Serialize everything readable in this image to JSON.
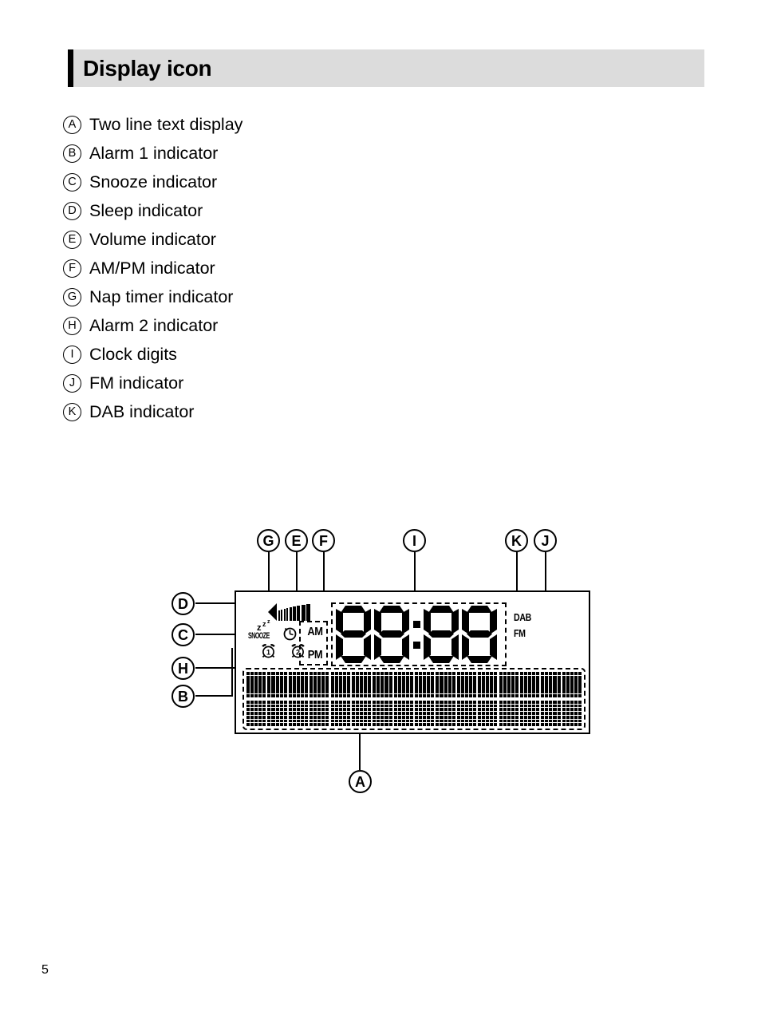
{
  "header": {
    "title": "Display icon",
    "bar_color": "#dcdcdc",
    "accent_color": "#000000"
  },
  "legend": {
    "items": [
      {
        "marker": "A",
        "label": "Two line text display"
      },
      {
        "marker": "B",
        "label": "Alarm 1 indicator"
      },
      {
        "marker": "C",
        "label": "Snooze indicator"
      },
      {
        "marker": "D",
        "label": "Sleep indicator"
      },
      {
        "marker": "E",
        "label": "Volume indicator"
      },
      {
        "marker": "F",
        "label": "AM/PM indicator"
      },
      {
        "marker": "G",
        "label": "Nap timer indicator"
      },
      {
        "marker": "H",
        "label": "Alarm 2 indicator"
      },
      {
        "marker": "I",
        "label": "Clock digits"
      },
      {
        "marker": "J",
        "label": "FM indicator"
      },
      {
        "marker": "K",
        "label": "DAB indicator"
      }
    ]
  },
  "diagram": {
    "callouts": {
      "g": "G",
      "e": "E",
      "f": "F",
      "i": "I",
      "k": "K",
      "j": "J",
      "d": "D",
      "c": "C",
      "h": "H",
      "b": "B",
      "a": "A"
    },
    "lcd": {
      "snooze_label": "SNOOZE",
      "sleep_icon": "zzz-sleep-icon",
      "volume_icon": "speaker-volume-icon",
      "nap_timer_icon": "nap-timer-clock-icon",
      "alarm1_icon": "alarm-bell-1-icon",
      "alarm2_icon": "alarm-bell-2-icon",
      "am_label": "AM",
      "pm_label": "PM",
      "clock_digits": "88:88",
      "dab_label": "DAB",
      "fm_label": "FM",
      "text_display_icon": "dot-matrix-two-line-text-display"
    }
  },
  "footer": {
    "page_number": "5"
  }
}
